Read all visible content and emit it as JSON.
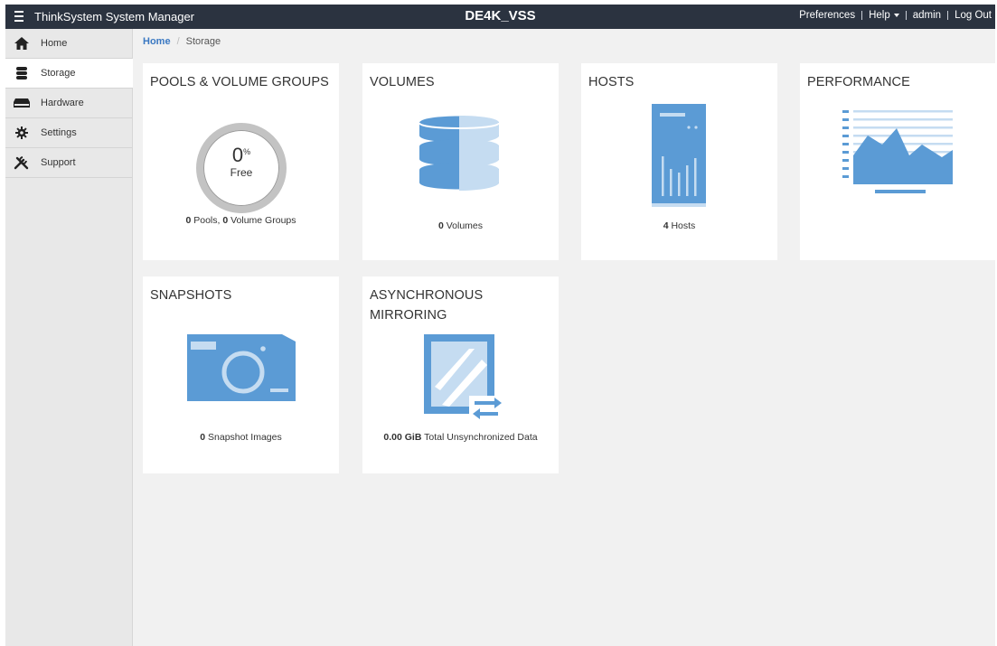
{
  "header": {
    "app_title": "ThinkSystem System Manager",
    "system_name": "DE4K_VSS",
    "links": {
      "preferences": "Preferences",
      "help": "Help",
      "admin": "admin",
      "logout": "Log Out"
    }
  },
  "sidebar": {
    "items": [
      {
        "label": "Home",
        "icon": "home-icon"
      },
      {
        "label": "Storage",
        "icon": "storage-icon"
      },
      {
        "label": "Hardware",
        "icon": "hardware-icon"
      },
      {
        "label": "Settings",
        "icon": "gear-icon"
      },
      {
        "label": "Support",
        "icon": "tools-icon"
      }
    ],
    "active": "Storage"
  },
  "breadcrumb": {
    "home": "Home",
    "current": "Storage"
  },
  "tiles": {
    "pools": {
      "title": "POOLS & VOLUME GROUPS",
      "free_value": "0",
      "free_unit": "%",
      "free_label": "Free",
      "caption_count1": "0",
      "caption_text1": " Pools, ",
      "caption_count2": "0",
      "caption_text2": " Volume Groups"
    },
    "volumes": {
      "title": "VOLUMES",
      "caption_count": "0",
      "caption_text": " Volumes"
    },
    "hosts": {
      "title": "HOSTS",
      "caption_count": "4",
      "caption_text": " Hosts"
    },
    "performance": {
      "title": "PERFORMANCE"
    },
    "snapshots": {
      "title": "SNAPSHOTS",
      "caption_count": "0",
      "caption_text": " Snapshot Images"
    },
    "mirroring": {
      "title": "ASYNCHRONOUS MIRRORING",
      "caption_count": "0.00 GiB",
      "caption_text": " Total Unsynchronized Data"
    }
  },
  "colors": {
    "topbar": "#2b3340",
    "accent_blue": "#5b9bd5",
    "light_blue": "#c5dcf1",
    "link_blue": "#3a78c2"
  }
}
